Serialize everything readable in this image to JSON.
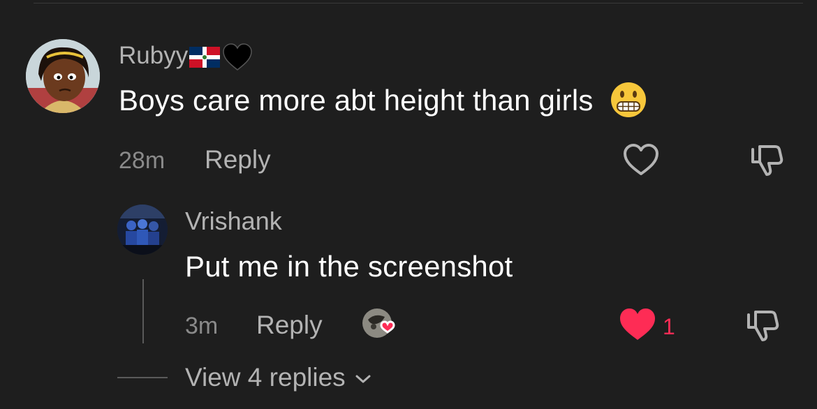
{
  "comment": {
    "username": "Rubyy",
    "text": "Boys care more abt height than girls",
    "emoji": "grimacing-face",
    "time": "28m",
    "reply_label": "Reply"
  },
  "reply": {
    "username": "Vrishank",
    "text": "Put me in the screenshot",
    "time": "3m",
    "reply_label": "Reply",
    "like_count": "1"
  },
  "view_replies": {
    "label": "View 4 replies"
  },
  "colors": {
    "background": "#1e1e1e",
    "liked": "#fe2c55",
    "muted": "#b3b3b3"
  }
}
